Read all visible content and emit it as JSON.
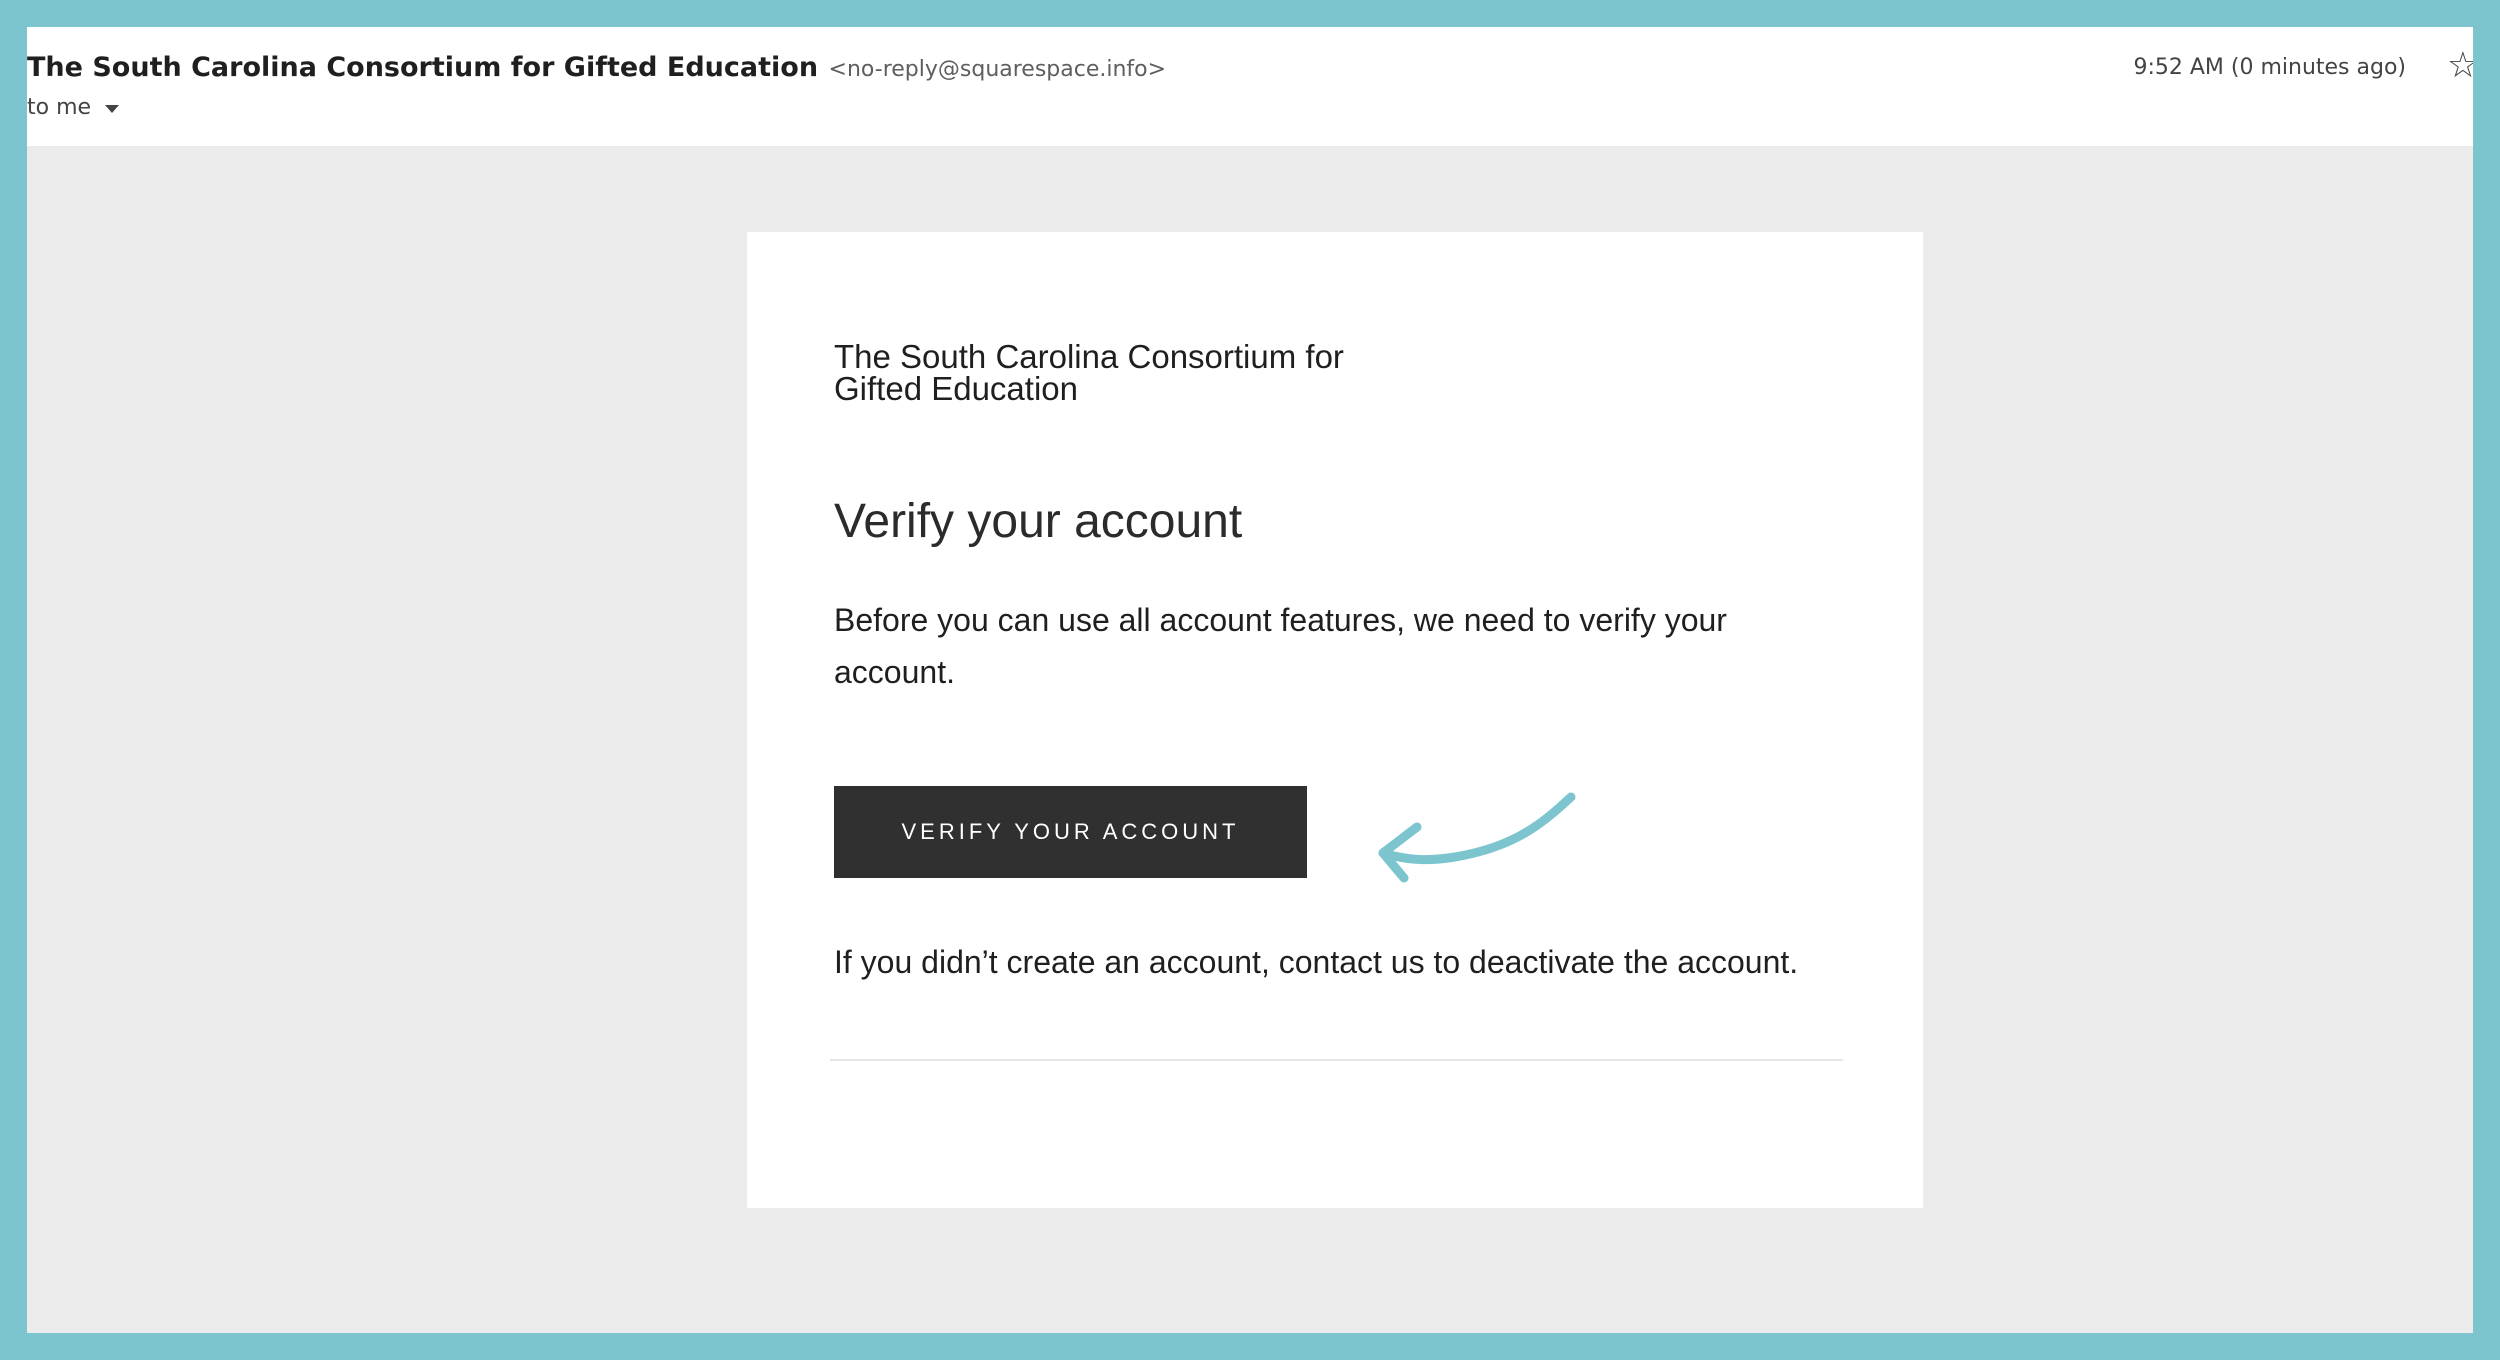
{
  "header": {
    "sender_name": "The South Carolina Consortium for Gifted Education",
    "sender_email": "<no-reply@squarespace.info>",
    "recipient": "to me",
    "timestamp": "9:52 AM (0 minutes ago)",
    "star_glyph": "☆"
  },
  "email": {
    "brand": "The South Carolina Consortium for Gifted Education",
    "heading": "Verify your account",
    "body": "Before you can use all account features, we need to verify your account.",
    "button_label": "VERIFY YOUR ACCOUNT",
    "footer": "If you didn’t create an account, contact us to deactivate the account."
  },
  "colors": {
    "frame": "#7cc5cf",
    "background": "#ebebeb",
    "button": "#303030",
    "arrow": "#7cc5cf"
  },
  "icons": {
    "star": "star-icon",
    "dropdown": "chevron-down-icon",
    "arrow": "curved-arrow-icon"
  }
}
